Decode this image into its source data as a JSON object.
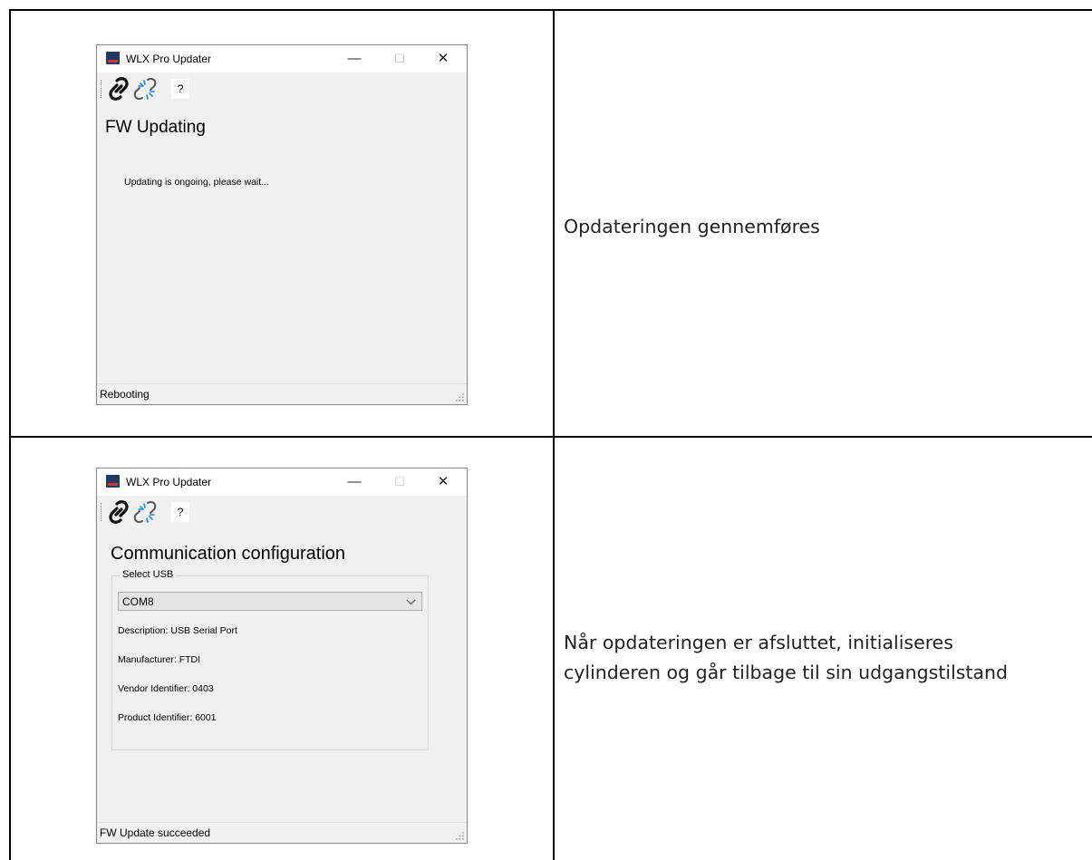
{
  "rows": [
    {
      "description": "Opdateringen gennemføres",
      "window": {
        "title": "WLX Pro Updater",
        "toolbar_help": "?",
        "heading": "FW Updating",
        "message": "Updating is ongoing, please wait...",
        "status": "Rebooting"
      }
    },
    {
      "description_lines": [
        "Når opdateringen er afsluttet, initialiseres",
        "cylinderen og går tilbage til sin udgangstilstand"
      ],
      "window": {
        "title": "WLX Pro Updater",
        "toolbar_help": "?",
        "heading": "Communication configuration",
        "group_label": "Select USB",
        "combo_value": "COM8",
        "description_field": "Description: USB Serial Port",
        "manufacturer_field": "Manufacturer: FTDI",
        "vendor_field": "Vendor Identifier: 0403",
        "product_field": "Product Identifier: 6001",
        "status": "FW Update succeeded"
      }
    }
  ],
  "window_controls": {
    "minimize": "—",
    "maximize": "☐",
    "close": "✕"
  },
  "icons": [
    "app-icon",
    "connect-icon",
    "disconnect-icon",
    "chevron-down-icon",
    "size-grip-icon"
  ]
}
